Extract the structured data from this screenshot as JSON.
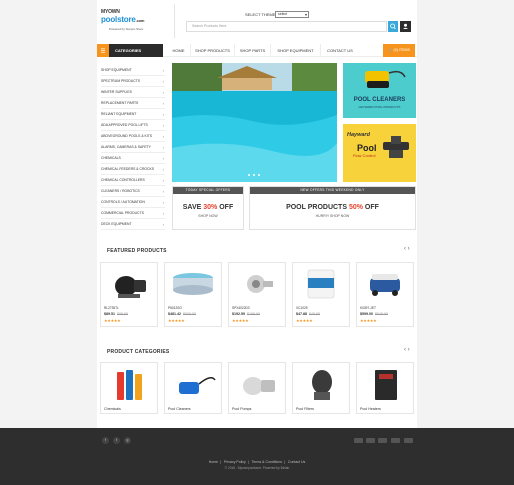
{
  "header": {
    "logo_line1": "MYOWN",
    "logo_line2": "poolstore",
    "logo_line3": ".com",
    "logo_tagline": "Powered by Sunpro Store",
    "theme_label": "SELECT THEME",
    "theme_value": "select",
    "search_placeholder": "Search Products Here"
  },
  "nav": {
    "categories_label": "CATEGORIES",
    "items": [
      "HOME",
      "SHOP PRODUCTS",
      "SHOP PARTS",
      "SHOP EQUIPMENT",
      "CONTACT US"
    ],
    "cart_label": "(0) ITEMS"
  },
  "sidebar": {
    "items": [
      "SHOP EQUIPMENT",
      "SPECTRUM PRODUCTS",
      "WINTER SUPPLIES",
      "REPLACEMENT PARTS",
      "RELIANT EQUIPMENT",
      "ADA APPROVED POOL LIFTS",
      "ABOVEGROUND POOLS & KITS",
      "ALARMS, CAMERAS & SAFETY",
      "CHEMICALS",
      "CHEMICAL FEEDERS & CROCKS",
      "CHEMICAL CONTROLLERS",
      "CLEANERS / ROBOTICS",
      "CONTROLS / AUTOMATION",
      "COMMERCIAL PRODUCTS",
      "DECK EQUIPMENT"
    ]
  },
  "promos": {
    "cleaners_title": "POOL CLEANERS",
    "cleaners_sub": "HAYWARD POOL PRODUCTS",
    "hayward_brand": "Hayward",
    "flow_title": "Pool",
    "flow_sub": "Flow Control"
  },
  "deals": [
    {
      "tag": "TODAY SPECIAL OFFERS",
      "text1": "SAVE ",
      "pct": "30%",
      "text2": " OFF",
      "sub": "SHOP NOW"
    },
    {
      "tag": "NEW OFFERS THIS WEEKEND ONLY",
      "text1": "POOL PRODUCTS ",
      "pct": "50%",
      "text2": " OFF",
      "sub": "HURRY! SHOP NOW"
    }
  ],
  "featured": {
    "title": "FEATURED PRODUCTS",
    "products": [
      {
        "name": "RL2735TL",
        "price": "$89.51",
        "old": "$99.95",
        "stars": "★★★★★"
      },
      {
        "name": "P6012SO",
        "price": "$481.42",
        "old": "$509.50",
        "stars": "★★★★★"
      },
      {
        "name": "SPX4022D3",
        "price": "$192.59",
        "old": "$198.95",
        "stars": "★★★★★"
      },
      {
        "name": "XC1025",
        "price": "$47.88",
        "old": "$49.95",
        "stars": "★★★★★"
      },
      {
        "name": "K0397-JET",
        "price": "$599.00",
        "old": "$649.95",
        "stars": "★★★★★"
      }
    ]
  },
  "categories": {
    "title": "PRODUCT CATEGORIES",
    "items": [
      "Chemicals",
      "Pool Cleaners",
      "Pool Pumps",
      "Pool Filters",
      "Pool Heaters"
    ]
  },
  "footer": {
    "social": [
      "f",
      "t",
      "g"
    ],
    "links": [
      "Home",
      "Privacy Policy",
      "Terms & Conditions",
      "Contact Us"
    ],
    "copyright": "© 2016 - Myownpoolstore. Powered by Bizlab"
  },
  "colors": {
    "accent": "#f7941d",
    "dark": "#2b2b2b",
    "blue": "#1e90d6",
    "sale": "#e8402a"
  }
}
